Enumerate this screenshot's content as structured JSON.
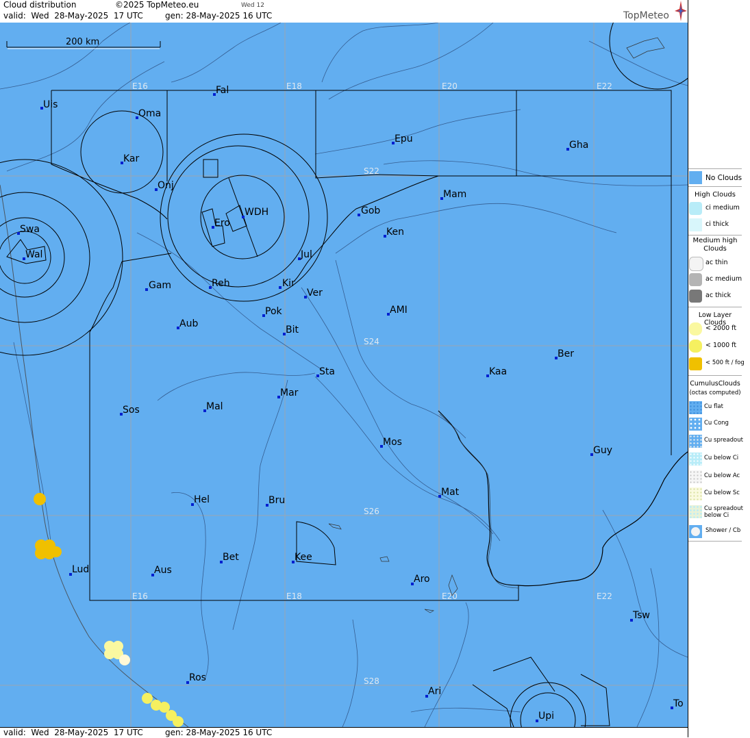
{
  "header": {
    "title": "Cloud distribution",
    "copyright": "©2025 TopMeteo.eu",
    "day_tag": "Wed 12",
    "valid": "valid:  Wed  28-May-2025  17 UTC",
    "gen": "gen: 28-May-2025 16 UTC",
    "logo": "TopMeteo"
  },
  "footer": {
    "valid": "valid:  Wed  28-May-2025  17 UTC",
    "gen": "gen: 28-May-2025 16 UTC"
  },
  "map": {
    "scale_label": "200 km",
    "colors": {
      "sea_land_no_clouds": "#62aef0",
      "low_lt2000": "#faf8a0",
      "low_lt1000": "#f5f060",
      "fog": "#f0c000"
    },
    "grid_labels": {
      "lon_top": [
        "E16",
        "E18",
        "E20",
        "E22"
      ],
      "lon_bottom": [
        "E16",
        "E18",
        "E20",
        "E22"
      ],
      "lat": [
        "S22",
        "S24",
        "S26",
        "S28"
      ]
    },
    "cities": [
      {
        "name": "Uis"
      },
      {
        "name": "Fal"
      },
      {
        "name": "Oma"
      },
      {
        "name": "Kar"
      },
      {
        "name": "Epu"
      },
      {
        "name": "Gha"
      },
      {
        "name": "Onj"
      },
      {
        "name": "Mam"
      },
      {
        "name": "Swa"
      },
      {
        "name": "WDH"
      },
      {
        "name": "Ero"
      },
      {
        "name": "Gob"
      },
      {
        "name": "Ken"
      },
      {
        "name": "Wal"
      },
      {
        "name": "Jul"
      },
      {
        "name": "Gam"
      },
      {
        "name": "Reh"
      },
      {
        "name": "Kir"
      },
      {
        "name": "Ver"
      },
      {
        "name": "Pok"
      },
      {
        "name": "AMI"
      },
      {
        "name": "Aub"
      },
      {
        "name": "Bit"
      },
      {
        "name": "Ber"
      },
      {
        "name": "Sta"
      },
      {
        "name": "Kaa"
      },
      {
        "name": "Mar"
      },
      {
        "name": "Sos"
      },
      {
        "name": "Mal"
      },
      {
        "name": "Mos"
      },
      {
        "name": "Guy"
      },
      {
        "name": "Mat"
      },
      {
        "name": "Hel"
      },
      {
        "name": "Bru"
      },
      {
        "name": "Bet"
      },
      {
        "name": "Kee"
      },
      {
        "name": "Lud"
      },
      {
        "name": "Aus"
      },
      {
        "name": "Aro"
      },
      {
        "name": "Tsw"
      },
      {
        "name": "Ros"
      },
      {
        "name": "Ari"
      },
      {
        "name": "Upi"
      },
      {
        "name": "To"
      }
    ]
  },
  "legend": {
    "no_clouds": "No Clouds",
    "high": {
      "title": "High Clouds",
      "items": [
        "ci medium",
        "ci thick"
      ]
    },
    "medium": {
      "title": "Medium high Clouds",
      "items": [
        "ac thin",
        "ac medium",
        "ac thick"
      ]
    },
    "low": {
      "title": "Low Layer Clouds",
      "items": [
        "< 2000 ft",
        "< 1000 ft",
        "< 500 ft / fog"
      ]
    },
    "cumulus": {
      "title": "CumulusClouds",
      "subtitle": "(octas computed)",
      "items": [
        "Cu flat",
        "Cu Cong",
        "Cu spreadout",
        "Cu below Ci",
        "Cu below Ac",
        "Cu below Sc",
        "Cu spreadout below Ci",
        "Shower / Cb"
      ]
    }
  }
}
